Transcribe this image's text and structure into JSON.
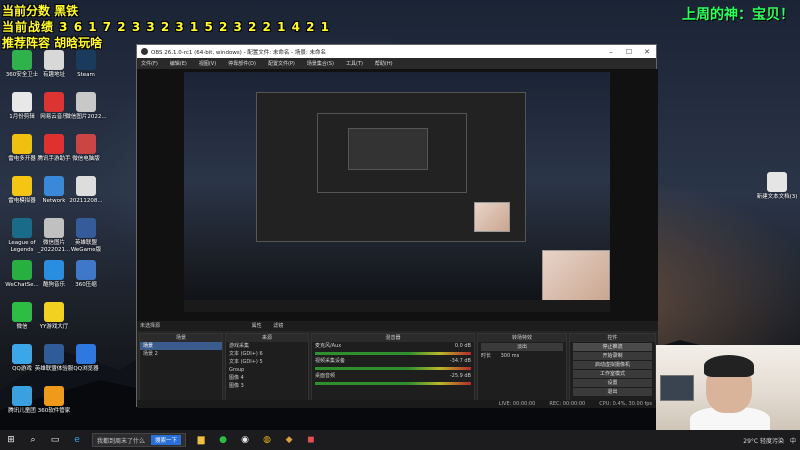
{
  "overlay": {
    "score_line": "当前分数 黑铁",
    "record_line": "当前战绩 3 6 1 7 2 3 3 2 3 1 5 2 3 2 2 1 4 2 1",
    "lineup_line": "推荐阵容 胡晗玩啥",
    "god_line": "上周的神：宝贝！"
  },
  "desktop_icons": [
    {
      "label": "360安全卫士",
      "color": "#2fb14b"
    },
    {
      "label": "有趣地址",
      "color": "#d8d8d8"
    },
    {
      "label": "Steam",
      "color": "#1b3b5c"
    },
    {
      "label": "1月份剪辑",
      "color": "#e8e8e8"
    },
    {
      "label": "网易云音乐",
      "color": "#d33"
    },
    {
      "label": "微信图片2022...",
      "color": "#c8c8c8"
    },
    {
      "label": "雷电多开器",
      "color": "#f0c010"
    },
    {
      "label": "腾讯手游助手",
      "color": "#e03030"
    },
    {
      "label": "微信电脑版",
      "color": "#cc4444"
    },
    {
      "label": "雷电模拟器",
      "color": "#f5c514"
    },
    {
      "label": "Network",
      "color": "#3a88d8"
    },
    {
      "label": "20211208...",
      "color": "#dddddd"
    },
    {
      "label": "League of Legends",
      "color": "#1a6b8a"
    },
    {
      "label": "微信图片_2022021...",
      "color": "#c0c0c0"
    },
    {
      "label": "英雄联盟WeGame版",
      "color": "#355b9a"
    },
    {
      "label": "WeChatSe...",
      "color": "#27b040"
    },
    {
      "label": "酷狗音乐",
      "color": "#2a8ee0"
    },
    {
      "label": "360压缩",
      "color": "#3f77c9"
    },
    {
      "label": "微信",
      "color": "#2dbd45"
    },
    {
      "label": "YY游戏大厅",
      "color": "#f2d11f"
    },
    {
      "label": "QQ游戏",
      "color": "#3ba6e8"
    },
    {
      "label": "英雄联盟体验服",
      "color": "#2f5c99"
    },
    {
      "label": "QQ浏览器",
      "color": "#2f78e0"
    },
    {
      "label": "腾讯儿童团",
      "color": "#3aa0e0"
    },
    {
      "label": "360软件管家",
      "color": "#ef9a1a"
    },
    {
      "label": "新建文本文档(3)",
      "color": "#e5e5e5"
    }
  ],
  "obs": {
    "title": "OBS 26.1.0-rc1 (64-bit, windows) - 配置文件: 未命名 - 场景: 未命名",
    "menu": [
      "文件(F)",
      "编辑(E)",
      "视图(V)",
      "停靠部件(D)",
      "配置文件(P)",
      "场景集合(S)",
      "工具(T)",
      "帮助(H)"
    ],
    "source_bar_label": "未选择源",
    "prop_buttons": [
      "属性",
      "滤镜"
    ],
    "docks": {
      "scenes": {
        "title": "场景",
        "items": [
          "场景",
          "场景 2"
        ]
      },
      "sources": {
        "title": "来源",
        "items": [
          "游戏采集",
          "文本 (GDI+) 6",
          "文本 (GDI+) 5",
          "Group",
          "图像 4",
          "图像 3"
        ]
      },
      "mixer": {
        "title": "混音器",
        "channels": [
          {
            "name": "麦克风/Aux",
            "db": "0.0 dB"
          },
          {
            "name": "视频采集设备",
            "db": "-34.7 dB"
          },
          {
            "name": "桌面音频",
            "db": "-25.9 dB"
          }
        ]
      },
      "transitions": {
        "title": "转场特效",
        "mode": "淡出",
        "duration_label": "时长",
        "duration": "300 ms"
      },
      "controls": {
        "title": "控件",
        "buttons": [
          "停止推流",
          "开始录制",
          "启动虚拟摄像机",
          "工作室模式",
          "设置",
          "退出"
        ]
      }
    },
    "status": {
      "live": "LIVE: 00:00:00",
      "rec": "REC: 00:00:00",
      "cpu": "CPU: 0.4%, 30.00 fps"
    }
  },
  "taskbar": {
    "search_text": "我都到周末了什么",
    "search_button": "搜索一下",
    "weather": "29°C 轻度污染",
    "time_label": "中"
  }
}
